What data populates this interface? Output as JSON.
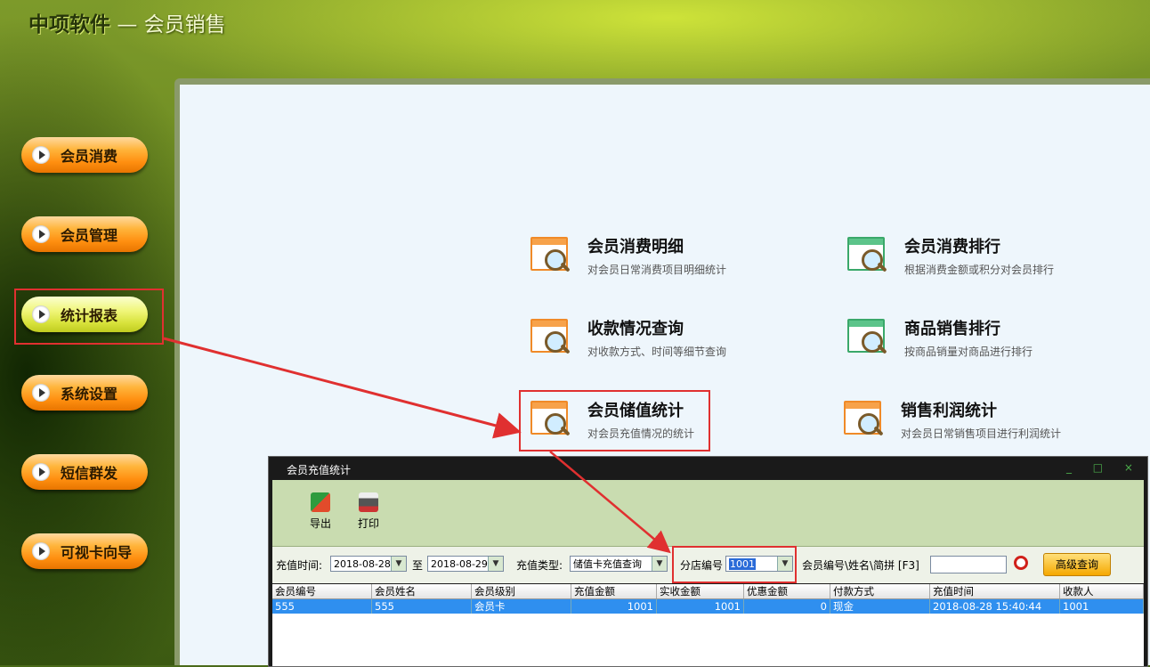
{
  "app": {
    "brand": "中项软件",
    "title_sep": "—",
    "title": "会员销售"
  },
  "sidebar": {
    "items": [
      {
        "label": "会员消费",
        "active": false
      },
      {
        "label": "会员管理",
        "active": false
      },
      {
        "label": "统计报表",
        "active": true
      },
      {
        "label": "系统设置",
        "active": false
      },
      {
        "label": "短信群发",
        "active": false
      },
      {
        "label": "可视卡向导",
        "active": false
      }
    ]
  },
  "reports": [
    {
      "title": "会员消费明细",
      "desc": "对会员日常消费项目明细统计",
      "icon": "report-search-orange-icon"
    },
    {
      "title": "会员消费排行",
      "desc": "根据消费金额或积分对会员排行",
      "icon": "report-search-green-icon"
    },
    {
      "title": "收款情况查询",
      "desc": "对收款方式、时间等细节查询",
      "icon": "report-search-orange-icon"
    },
    {
      "title": "商品销售排行",
      "desc": "按商品销量对商品进行排行",
      "icon": "report-search-green-icon"
    },
    {
      "title": "会员储值统计",
      "desc": "对会员充值情况的统计",
      "icon": "report-search-orange-icon"
    },
    {
      "title": "销售利润统计",
      "desc": "对会员日常销售项目进行利润统计",
      "icon": "report-search-orange-icon"
    }
  ],
  "dialog": {
    "title": "会员充值统计",
    "controls": "_ □ ×",
    "toolbar": {
      "export": "导出",
      "print": "打印"
    },
    "filters": {
      "time_label": "充值时间:",
      "date_from": "2018-08-28",
      "to_label": "至",
      "date_to": "2018-08-29",
      "type_label": "充值类型:",
      "type_value": "储值卡充值查询",
      "branch_label": "分店编号",
      "branch_value": "1001",
      "search_label": "会员编号\\姓名\\简拼 [F3]",
      "search_value": "",
      "advanced_button": "高级查询"
    },
    "table": {
      "columns": [
        "会员编号",
        "会员姓名",
        "会员级别",
        "充值金额",
        "实收金额",
        "优惠金额",
        "付款方式",
        "充值时间",
        "收款人"
      ],
      "rows": [
        [
          "555",
          "555",
          "会员卡",
          "1001",
          "1001",
          "0",
          "现金",
          "2018-08-28 15:40:44",
          "1001"
        ]
      ]
    }
  },
  "colors": {
    "accent_red": "#e03030",
    "selection_blue": "#2f8fef",
    "nav_orange": "#ff8f10",
    "nav_active": "#d7e23a"
  }
}
